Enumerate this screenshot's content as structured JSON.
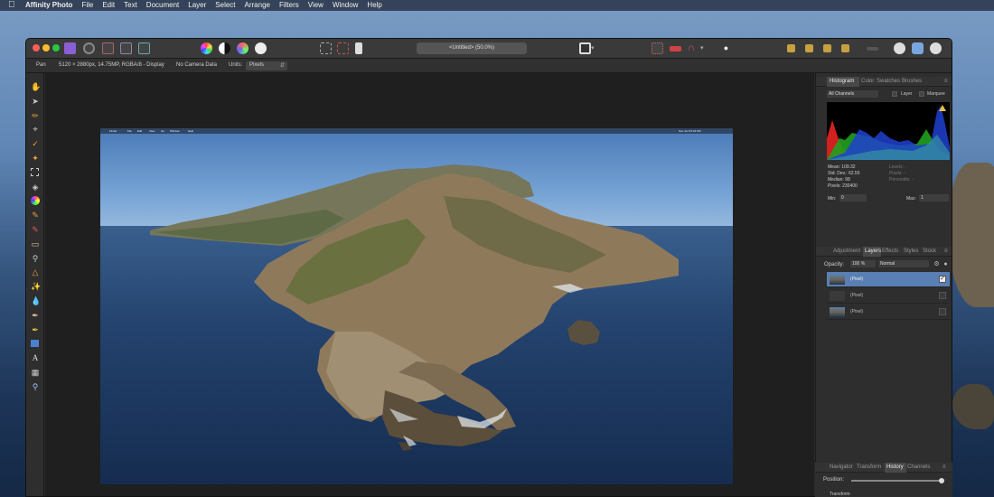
{
  "menubar": {
    "app_name": "Affinity Photo",
    "items": [
      "File",
      "Edit",
      "Text",
      "Document",
      "Layer",
      "Select",
      "Arrange",
      "Filters",
      "View",
      "Window",
      "Help"
    ]
  },
  "titlebar": {
    "document_title": "<Untitled> (50.0%)"
  },
  "context_toolbar": {
    "tool_name": "Pan",
    "doc_info": "5120 × 2880px, 14.75MP, RGBA/8 - Display",
    "camera_data": "No Camera Data",
    "units_label": "Units:",
    "units_value": "Pixels"
  },
  "histogram_panel": {
    "tabs": [
      "Histogram",
      "Color",
      "Swatches",
      "Brushes"
    ],
    "active_tab": "Histogram",
    "channel_select": "All Channels",
    "layer_option": "Layer",
    "marquee_option": "Marquee",
    "stats": {
      "mean": "Mean: 109.32",
      "std_dev": "Std. Dev.: 62.55",
      "median": "Median: 98",
      "pixels": "Pixels: 230400",
      "levels": "Levels: -",
      "pixels_right": "Pixels: -",
      "percentile": "Percentile: -"
    },
    "min_label": "Min:",
    "min_value": "0",
    "max_label": "Max:",
    "max_value": "1",
    "warning_icon": "warning-triangle-icon"
  },
  "layers_panel": {
    "tabs": [
      "Adjustment",
      "Layers",
      "Effects",
      "Styles",
      "Stock"
    ],
    "active_tab": "Layers",
    "opacity_label": "Opacity:",
    "opacity_value": "100 %",
    "blend_mode": "Normal",
    "layers": [
      {
        "name": "(Pixel)",
        "checked": true
      },
      {
        "name": "(Pixel)",
        "checked": false
      },
      {
        "name": "(Pixel)",
        "checked": false
      }
    ]
  },
  "navigator_panel": {
    "tabs": [
      "Navigator",
      "Transform",
      "History",
      "Channels"
    ],
    "active_tab": "History",
    "position_label": "Position:",
    "history_item": "Transform"
  },
  "document_inner_menubar": {
    "items": [
      "Finder",
      "File",
      "Edit",
      "View",
      "Go",
      "Window",
      "Help"
    ],
    "clock": "Sun Jul 8 6:34 PM"
  },
  "colors": {
    "accent_selected_layer": "#5a7fb5",
    "window_bg": "#2b2b2b",
    "canvas_bg": "#1f1f1f"
  }
}
